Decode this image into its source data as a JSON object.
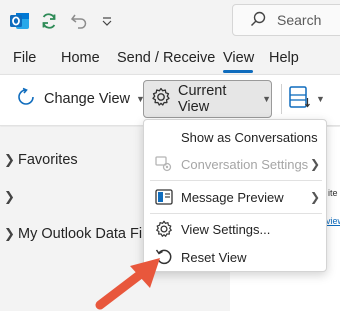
{
  "search": {
    "label": "Search"
  },
  "menu": {
    "tabs": [
      {
        "label": "File"
      },
      {
        "label": "Home"
      },
      {
        "label": "Send / Receive"
      },
      {
        "label": "View",
        "active": true
      },
      {
        "label": "Help"
      }
    ]
  },
  "ribbon": {
    "change_view": "Change View",
    "current_view": "Current View"
  },
  "folders": {
    "favorites": "Favorites",
    "unnamed": "",
    "data_file": "My Outlook Data Fil"
  },
  "right_pane": {
    "line1": "ite",
    "line2": "view"
  },
  "dropdown": {
    "show_as_conversations": "Show as Conversations",
    "conversation_settings": "Conversation Settings",
    "message_preview": "Message Preview",
    "view_settings": "View Settings...",
    "reset_view": "Reset View"
  },
  "colors": {
    "accent": "#0f6cbd",
    "outlook_blue": "#0f6cbd",
    "sync_green": "#2e8b57",
    "annotation_arrow": "#e8573c"
  }
}
